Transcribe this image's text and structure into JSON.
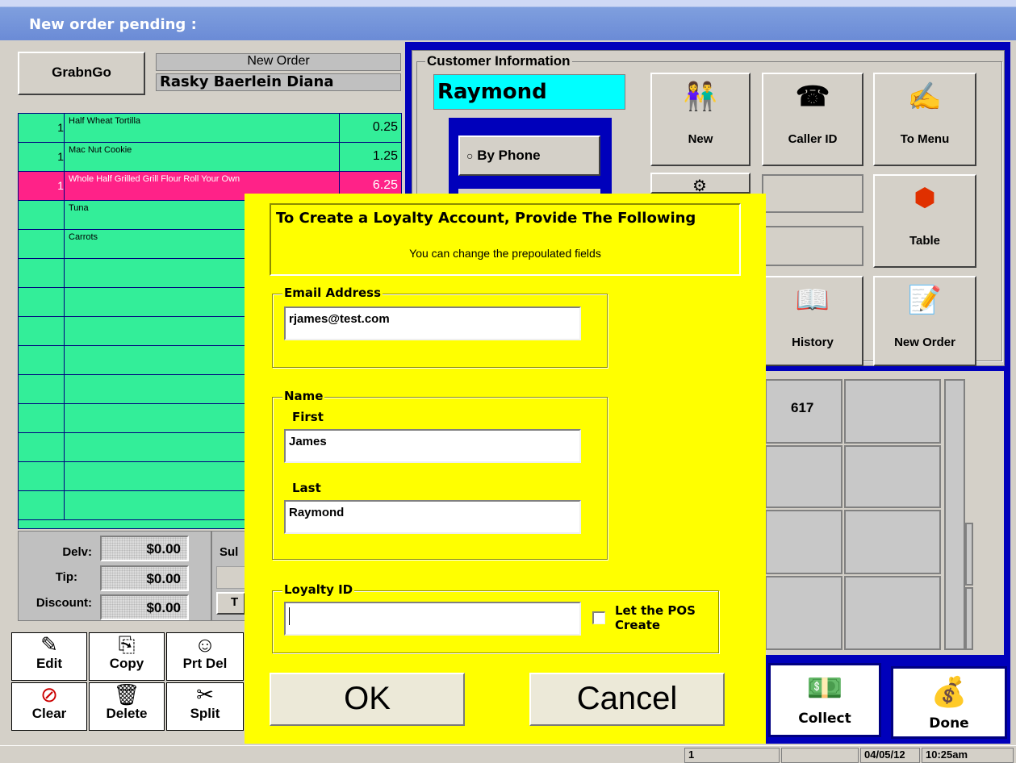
{
  "window": {
    "title": "New order pending :"
  },
  "header": {
    "mode_button": "GrabnGo",
    "order_label": "New Order",
    "customer_name": "Rasky Baerlein Diana"
  },
  "order_items": [
    {
      "qty": "1",
      "name": "Half Wheat Tortilla",
      "price": "0.25",
      "selected": false
    },
    {
      "qty": "1",
      "name": "Mac Nut Cookie",
      "price": "1.25",
      "selected": false
    },
    {
      "qty": "1",
      "name": "Whole Half Grilled Grill Flour Roll Your Own",
      "price": "6.25",
      "selected": true
    },
    {
      "qty": "",
      "name": "Tuna",
      "price": "",
      "selected": false
    },
    {
      "qty": "",
      "name": "Carrots",
      "price": "",
      "selected": false
    }
  ],
  "totals": {
    "delivery_label": "Delv:",
    "delivery_value": "$0.00",
    "tip_label": "Tip:",
    "tip_value": "$0.00",
    "discount_label": "Discount:",
    "discount_value": "$0.00",
    "subtotal_label_partial": "Sul",
    "total_label_partial": "T"
  },
  "tools": {
    "edit": "Edit",
    "copy": "Copy",
    "prt_del": "Prt Del",
    "clear": "Clear",
    "delete": "Delete",
    "split": "Split"
  },
  "customer_panel": {
    "group_label": "Customer Information",
    "name_value": "Raymond",
    "by_phone": "By Phone",
    "buttons": {
      "new": "New",
      "caller_id": "Caller ID",
      "to_menu": "To Menu",
      "table": "Table",
      "history": "History",
      "new_order": "New Order"
    },
    "table_cell_617": "617"
  },
  "bottom_buttons": {
    "collect": "Collect",
    "done": "Done"
  },
  "dialog": {
    "title": "To Create a Loyalty Account, Provide The Following",
    "subtitle": "You can change the prepoulated fields",
    "email_group": "Email Address",
    "email_value": "rjames@test.com",
    "name_group": "Name",
    "first_label": "First",
    "first_value": "James",
    "last_label": "Last",
    "last_value": "Raymond",
    "loyalty_group": "Loyalty ID",
    "loyalty_value": "",
    "let_pos_create": "Let the POS",
    "let_pos_create_2": "Create",
    "ok": "OK",
    "cancel": "Cancel"
  },
  "statusbar": {
    "field1": "1",
    "date": "04/05/12",
    "time": "10:25am"
  },
  "colors": {
    "order_green": "#33ee99",
    "selected_pink": "#ff2288",
    "dialog_yellow": "#ffff00",
    "panel_blue": "#0000bb",
    "name_cyan": "#00ffff"
  }
}
